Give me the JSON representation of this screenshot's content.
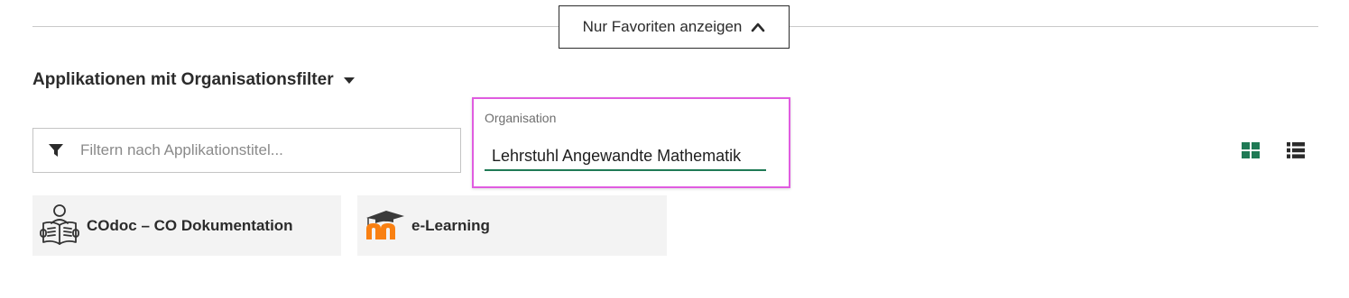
{
  "favorites_toggle": {
    "label": "Nur Favoriten anzeigen",
    "icon": "chevron-up-icon"
  },
  "section": {
    "heading": "Applikationen mit Organisationsfilter",
    "icon": "caret-down-icon"
  },
  "filter": {
    "placeholder": "Filtern nach Applikationstitel...",
    "value": "",
    "icon": "funnel-icon"
  },
  "organisation": {
    "label": "Organisation",
    "value": "Lehrstuhl Angewandte Mathematik"
  },
  "view_toggle": {
    "grid_icon": "grid-view-icon",
    "list_icon": "list-view-icon",
    "active": "grid",
    "active_color": "#1f7a55"
  },
  "tiles": [
    {
      "title": "COdoc – CO Dokumentation",
      "icon": "reading-person-icon"
    },
    {
      "title": "e-Learning",
      "icon": "moodle-logo-icon"
    }
  ],
  "colors": {
    "accent": "#1f7a55",
    "focus_outline": "#e05ce0",
    "tile_bg": "#f3f3f3"
  }
}
